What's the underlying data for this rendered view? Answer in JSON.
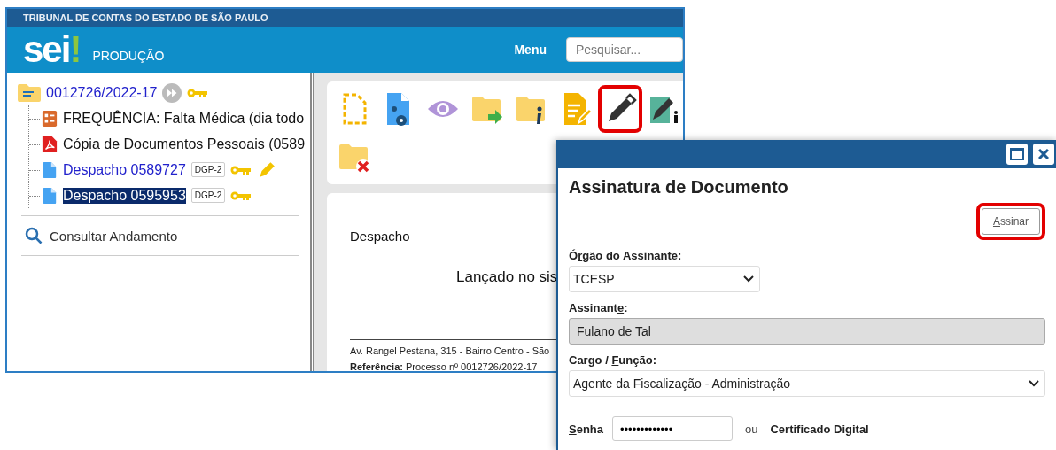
{
  "header": {
    "org": "TRIBUNAL DE CONTAS DO ESTADO DE SÃO PAULO",
    "logo": {
      "text": "sei",
      "mark": "!"
    },
    "environment": "PRODUÇÃO",
    "menu": "Menu",
    "search": {
      "placeholder": "Pesquisar..."
    }
  },
  "tree": {
    "label": "0012726/2022-17",
    "color": "#2222cc",
    "forward": true,
    "key": true,
    "children": [
      {
        "kind": "form",
        "label": "FREQUÊNCIA: Falta Médica (dia todo",
        "color": "#111111",
        "selected": false
      },
      {
        "kind": "pdf",
        "label": "Cópia de Documentos Pessoais (0589",
        "color": "#111111",
        "selected": false
      },
      {
        "kind": "doc",
        "label": "Despacho 0589727",
        "color": "#2222cc",
        "selected": false,
        "badge": "DGP-2",
        "key": true,
        "pen": true
      },
      {
        "kind": "doc",
        "label": "Despacho 0595953",
        "selected": true,
        "badge": "DGP-2",
        "key": true,
        "pen": false
      }
    ]
  },
  "side_links": [
    {
      "label": "Consultar Andamento"
    }
  ],
  "toolbar": [
    {
      "kind": "new-doc",
      "highlighted": false
    },
    {
      "kind": "doc-people",
      "highlighted": false
    },
    {
      "kind": "eye",
      "highlighted": false
    },
    {
      "kind": "folder-send",
      "highlighted": false
    },
    {
      "kind": "folder-info",
      "highlighted": false
    },
    {
      "kind": "edit-doc",
      "highlighted": false
    },
    {
      "kind": "sign",
      "highlighted": true
    },
    {
      "kind": "sign-building",
      "highlighted": false
    },
    {
      "kind": "folder-delete",
      "highlighted": false
    }
  ],
  "document": {
    "title": "Despacho",
    "body": "Lançado no sis",
    "address": "Av. Rangel Pestana, 315 - Bairro Centro - São",
    "reference": "**Referência:** Processo nº 0012726/2022-17"
  },
  "dialog": {
    "title": "Assinatura de Documento",
    "submit": {
      "key": "A",
      "post": "ssinar",
      "highlighted": true
    },
    "fields": [
      {
        "kind": "select",
        "label": {
          "pre": "Ó",
          "key": "r",
          "post": "gão do Assinante:"
        },
        "value": "TCESP",
        "wide": false,
        "disabled": false
      },
      {
        "kind": "text",
        "label": {
          "pre": "Assinant",
          "key": "e",
          "post": ":"
        },
        "value": "Fulano de Tal",
        "wide": true,
        "disabled": true
      },
      {
        "kind": "select",
        "label": {
          "pre": "Cargo / ",
          "key": "F",
          "post": "unção:"
        },
        "value": "Agente da Fiscalização - Administração",
        "wide": true,
        "disabled": false
      }
    ],
    "password": {
      "label": {
        "key": "S",
        "post": "enha"
      },
      "value": "•••••••••••••"
    },
    "or": "ou",
    "certificate": "Certificado Digital"
  }
}
